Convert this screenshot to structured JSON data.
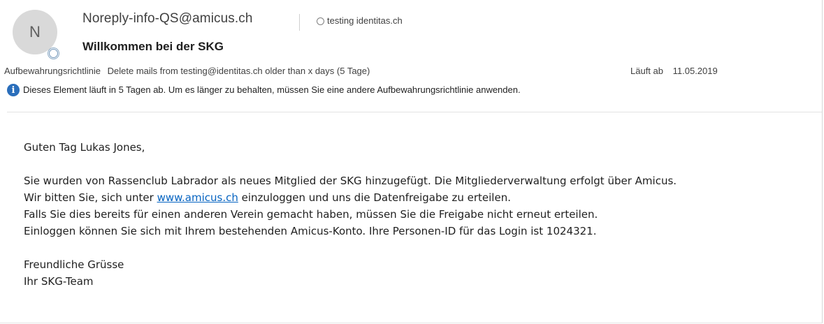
{
  "header": {
    "avatar_initial": "N",
    "sender": "Noreply-info-QS@amicus.ch",
    "recipient": "testing identitas.ch",
    "subject": "Willkommen bei der SKG"
  },
  "retention": {
    "label": "Aufbewahrungsrichtlinie",
    "policy": "Delete mails from testing@identitas.ch older than x days (5 Tage)",
    "expires_label": "Läuft ab",
    "expires_date": "11.05.2019"
  },
  "info_bar": {
    "icon": "info-icon",
    "text": "Dieses Element läuft in 5 Tagen ab. Um es länger zu behalten, müssen Sie eine andere Aufbewahrungsrichtlinie anwenden."
  },
  "body": {
    "greeting": "Guten Tag Lukas Jones,",
    "p1": "Sie wurden von Rassenclub Labrador als neues Mitglied der SKG hinzugefügt. Die Mitgliederverwaltung erfolgt über Amicus.",
    "p2_before": "Wir bitten Sie, sich unter ",
    "p2_link": "www.amicus.ch",
    "p2_after": " einzuloggen und uns die Datenfreigabe zu erteilen.",
    "p3": "Falls Sie dies bereits für einen anderen Verein gemacht haben, müssen Sie die Freigabe nicht erneut erteilen.",
    "p4": "Einloggen können Sie sich mit Ihrem bestehenden Amicus-Konto. Ihre Personen-ID für das Login ist 1024321.",
    "closing": "Freundliche Grüsse",
    "signature": "Ihr SKG-Team"
  },
  "colors": {
    "link": "#0563c1",
    "info_icon": "#2a6ebb",
    "avatar_bg": "#d9d9d9"
  }
}
